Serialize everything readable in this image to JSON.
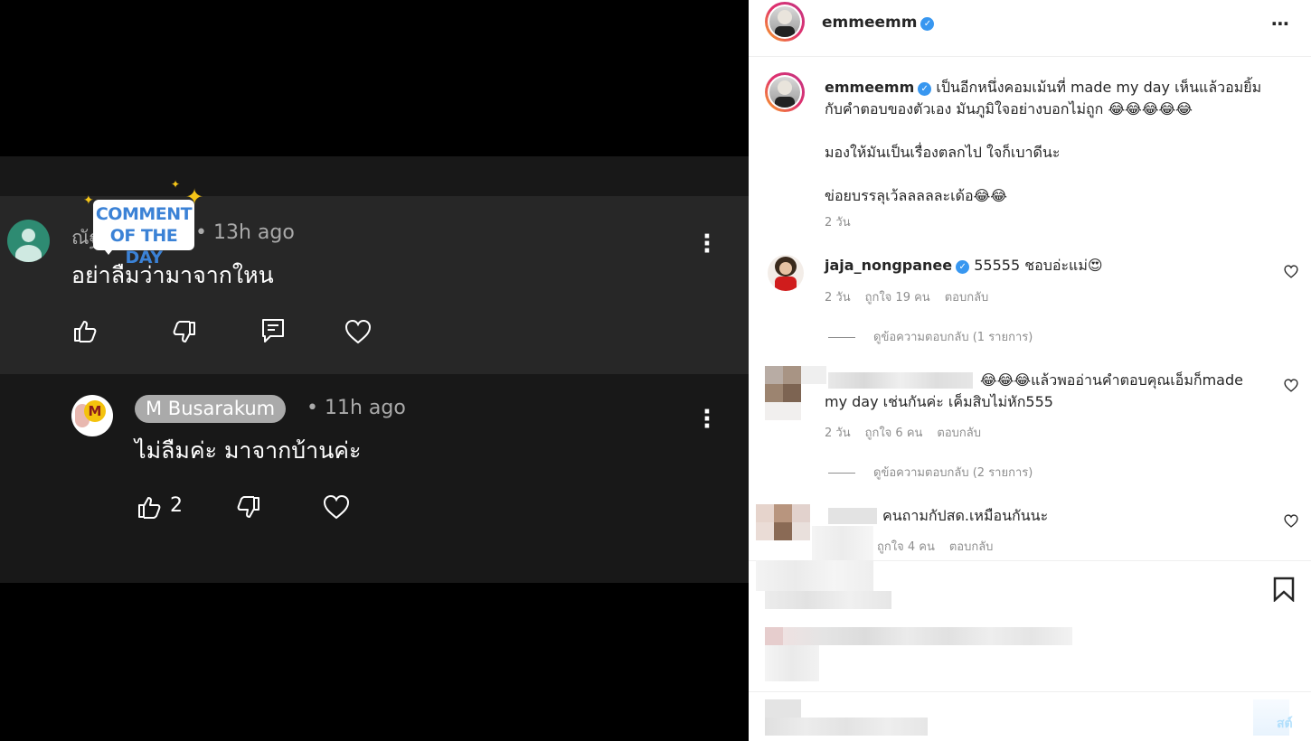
{
  "video_comments": {
    "comment1": {
      "author": "ณัฐ",
      "time": "13h ago",
      "text": "อย่าลืมว่ามาจากใหน",
      "badge_line1": "COMMENT",
      "badge_line2": "OF THE DAY"
    },
    "comment2": {
      "author": "M Busarakum",
      "time": "11h ago",
      "text": "ไม่ลืมค่ะ มาจากบ้านค่ะ",
      "like_count": "2",
      "avatar_letter": "M"
    }
  },
  "post": {
    "author": "emmeemm",
    "verified_mark": "✓",
    "caption_line1": "เป็นอีกหนึ่งคอมเม้นที่ made my day เห็นแล้วอมยิ้ม",
    "caption_line2": "กับคำตอบของตัวเอง มันภูมิใจอย่างบอกไม่ถูก 😂😂😂😂😂",
    "caption_line3": "มองให้มันเป็นเรื่องตลกไป ใจก็เบาดีนะ",
    "caption_line4": "ข่อยบรรลุเว้ลลลลละเด้อ😂😂",
    "caption_time": "2 วัน",
    "more_icon": "⋯"
  },
  "comments": [
    {
      "user": "jaja_nongpanee",
      "text": "55555 ชอบอ่ะแม่😍",
      "time": "2 วัน",
      "likes": "ถูกใจ 19 คน",
      "reply": "ตอบกลับ",
      "view_replies": "ดูข้อความตอบกลับ (1 รายการ)"
    },
    {
      "user": "",
      "text_line1": "😂😂😂แล้วพออ่านคำตอบคุณเอ็มก็made",
      "text_line2": "my day เช่นกันค่ะ เค็มสิบไม่หัก555",
      "time": "2 วัน",
      "likes": "ถูกใจ 6 คน",
      "reply": "ตอบกลับ",
      "view_replies": "ดูข้อความตอบกลับ (2 รายการ)"
    },
    {
      "user": "",
      "text": "คนถามกัปสด.เหมือนกันนะ",
      "likes": "ถูกใจ 4 คน",
      "reply": "ตอบกลับ"
    }
  ],
  "footer": {
    "post_label": "สต์"
  },
  "colors": {
    "ig_verified": "#3897f0",
    "yt_card": "#272727",
    "cotd_blue": "#3b82d6"
  }
}
